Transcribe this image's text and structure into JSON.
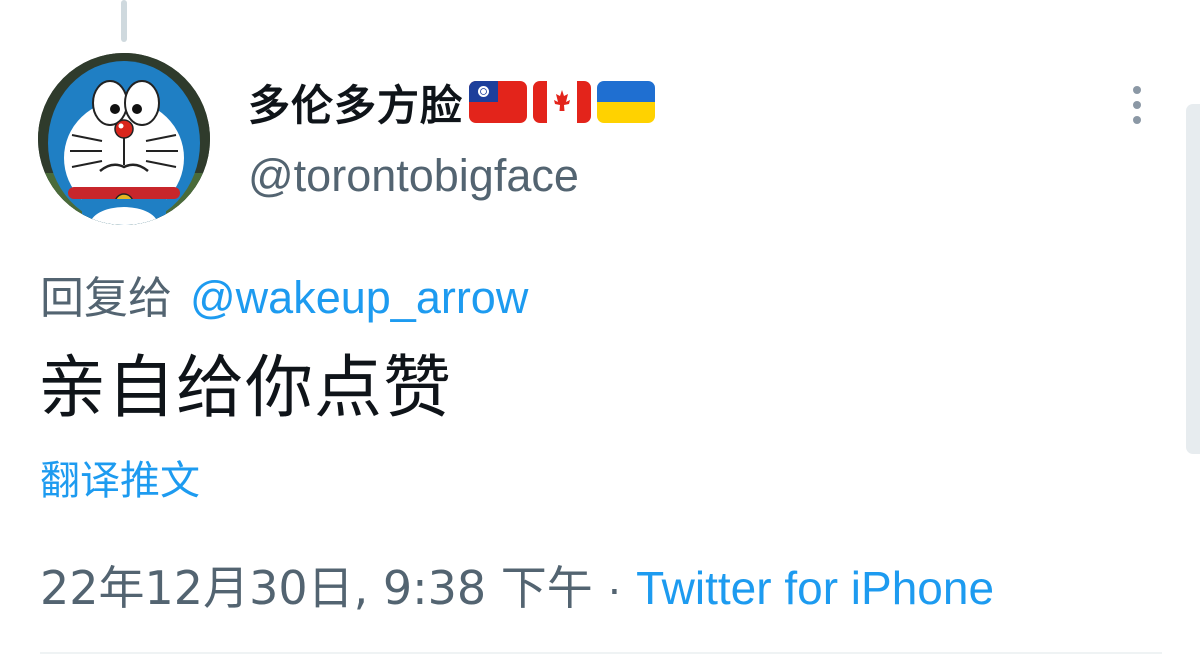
{
  "tweet": {
    "author": {
      "display_name": "多伦多方脸",
      "handle": "@torontobigface",
      "avatar": "doraemon-avatar",
      "flags": [
        "taiwan-flag",
        "canada-flag",
        "ukraine-flag"
      ]
    },
    "reply_prefix": "回复给",
    "reply_to": "@wakeup_arrow",
    "text": "亲自给你点赞",
    "translate_label": "翻译推文",
    "timestamp": "22年12月30日, 9:38 下午",
    "separator": "·",
    "source": "Twitter for iPhone",
    "more_icon": "more-vertical-icon"
  },
  "colors": {
    "text_primary": "#0f1419",
    "text_secondary": "#536471",
    "link": "#1d9bf0",
    "divider": "#eff3f4"
  }
}
